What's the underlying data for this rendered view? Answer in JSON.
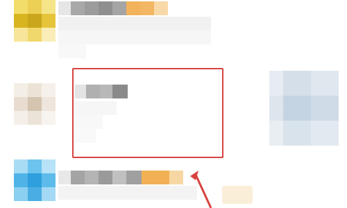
{
  "colors": {
    "highlight_border": "#d8423f",
    "arrow": "#d8423f",
    "accent_orange": "#f0b15a",
    "avatar_yellow": "#e7c53a",
    "avatar_blue": "#3aa8e0",
    "avatar_beige": "#e8ddd0",
    "thumb_blue": "#c8d8e8",
    "text_gray_dark": "#8e8e8e",
    "text_gray_light": "#ececec"
  },
  "icons": {
    "arrow": "red-pointer-arrow-icon"
  },
  "feed": {
    "items": [
      {
        "avatar": "yellow-avatar",
        "has_thumbnail": false
      },
      {
        "avatar": "beige-avatar",
        "has_thumbnail": true
      },
      {
        "avatar": "blue-avatar",
        "has_thumbnail": false
      }
    ]
  }
}
